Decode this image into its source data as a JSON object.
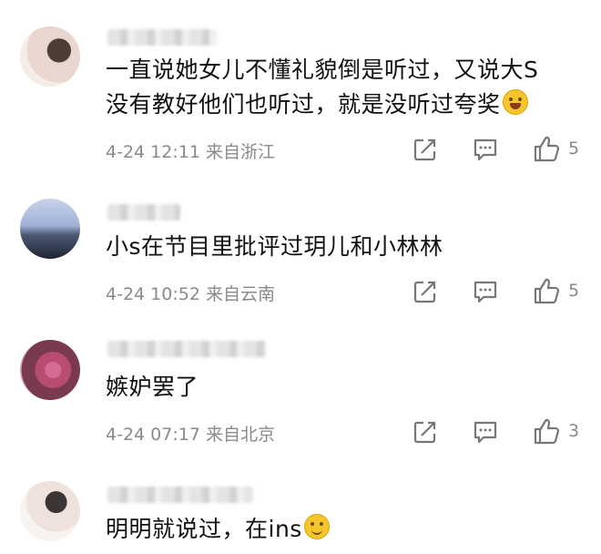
{
  "comments": [
    {
      "text_line1": "一直说她女儿不懂礼貌倒是听过，又说大S",
      "text_line2": "没有教好他们也听过，就是没听过夸奖",
      "emoji": "laughing-tears-emoji",
      "time": "4-24 12:11",
      "location": "来自浙江",
      "likes": "5"
    },
    {
      "text_line1": "小s在节目里批评过玥儿和小林林",
      "time": "4-24 10:52",
      "location": "来自云南",
      "likes": "5"
    },
    {
      "text_line1": "嫉妒罢了",
      "time": "4-24 07:17",
      "location": "来自北京",
      "likes": "3"
    },
    {
      "text_line1": "明明就说过，在ins",
      "emoji": "smile-emoji"
    }
  ],
  "icons": {
    "share": "share-icon",
    "reply": "comment-icon",
    "like": "thumbs-up-icon"
  },
  "colors": {
    "text": "#111111",
    "meta": "#8a8a8a",
    "icon": "#777777"
  }
}
